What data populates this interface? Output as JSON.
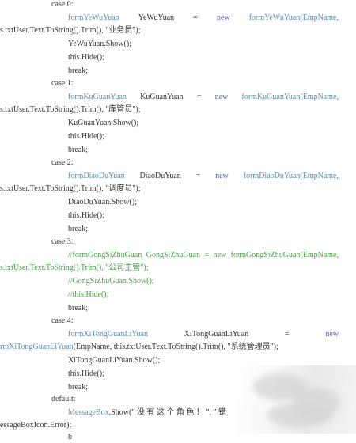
{
  "lines": [
    {
      "tokens": [
        {
          "text": "case 0:",
          "kind": "plain"
        }
      ]
    },
    {
      "tokens": [
        {
          "text": "formYeWuYuan",
          "kind": "type"
        },
        {
          "text": "YeWuYuan",
          "kind": "plain"
        },
        {
          "text": "=",
          "kind": "plain"
        },
        {
          "text": "new",
          "kind": "kw"
        },
        {
          "text": "formYeWuYuan(EmpName,",
          "kind": "type"
        }
      ]
    },
    {
      "tokens": [
        {
          "text": "s.txtUser.Text.ToString().Trim(), \"业务员\");",
          "kind": "plain"
        }
      ]
    },
    {
      "tokens": [
        {
          "text": "YeWuYuan.Show();",
          "kind": "plain"
        }
      ]
    },
    {
      "tokens": [
        {
          "text": "this.Hide();",
          "kind": "plain"
        }
      ]
    },
    {
      "tokens": [
        {
          "text": "break;",
          "kind": "plain"
        }
      ]
    },
    {
      "tokens": [
        {
          "text": "case 1:",
          "kind": "plain"
        }
      ]
    },
    {
      "tokens": [
        {
          "text": "formKuGuanYuan",
          "kind": "type"
        },
        {
          "text": "KuGuanYuan",
          "kind": "plain"
        },
        {
          "text": "=",
          "kind": "plain"
        },
        {
          "text": "new",
          "kind": "kw"
        },
        {
          "text": "formKuGuanYuan(EmpName,",
          "kind": "type"
        }
      ]
    },
    {
      "tokens": [
        {
          "text": "s.txtUser.Text.ToString().Trim(), \"库管员\");",
          "kind": "plain"
        }
      ]
    },
    {
      "tokens": [
        {
          "text": "KuGuanYuan.Show();",
          "kind": "plain"
        }
      ]
    },
    {
      "tokens": [
        {
          "text": "this.Hide();",
          "kind": "plain"
        }
      ]
    },
    {
      "tokens": [
        {
          "text": "break;",
          "kind": "plain"
        }
      ]
    },
    {
      "tokens": [
        {
          "text": "case 2:",
          "kind": "plain"
        }
      ]
    },
    {
      "tokens": [
        {
          "text": "formDiaoDuYuan",
          "kind": "type"
        },
        {
          "text": "DiaoDuYuan",
          "kind": "plain"
        },
        {
          "text": "=",
          "kind": "plain"
        },
        {
          "text": "new",
          "kind": "kw"
        },
        {
          "text": "formDiaoDuYuan(EmpName,",
          "kind": "type"
        }
      ]
    },
    {
      "tokens": [
        {
          "text": "s.txtUser.Text.ToString().Trim(), \"调度员\");",
          "kind": "plain"
        }
      ]
    },
    {
      "tokens": [
        {
          "text": "DiaoDuYuan.Show();",
          "kind": "plain"
        }
      ]
    },
    {
      "tokens": [
        {
          "text": "this.Hide();",
          "kind": "plain"
        }
      ]
    },
    {
      "tokens": [
        {
          "text": "break;",
          "kind": "plain"
        }
      ]
    },
    {
      "tokens": [
        {
          "text": "case 3:",
          "kind": "plain"
        }
      ]
    },
    {
      "tokens": [
        {
          "text": "//formGongSiZhuGuan",
          "kind": "comment"
        },
        {
          "text": "GongSiZhuGuan",
          "kind": "comment"
        },
        {
          "text": "=",
          "kind": "comment"
        },
        {
          "text": "new",
          "kind": "comment"
        },
        {
          "text": "formGongSiZhuGuan(EmpName,",
          "kind": "comment"
        }
      ]
    },
    {
      "tokens": [
        {
          "text": "s.txtUser.Text.ToString().Trim(), \"公司主管\");",
          "kind": "comment"
        }
      ]
    },
    {
      "tokens": [
        {
          "text": "//GongSiZhuGuan.Show();",
          "kind": "comment"
        }
      ]
    },
    {
      "tokens": [
        {
          "text": "//this.Hide();",
          "kind": "comment"
        }
      ]
    },
    {
      "tokens": [
        {
          "text": "break;",
          "kind": "plain"
        }
      ]
    },
    {
      "tokens": [
        {
          "text": "case 4:",
          "kind": "plain"
        }
      ]
    },
    {
      "tokens": [
        {
          "text": "formXiTongGuanLiYuan",
          "kind": "type"
        },
        {
          "text": "XiTongGuanLiYuan",
          "kind": "plain"
        },
        {
          "text": "=",
          "kind": "plain"
        },
        {
          "text": "new",
          "kind": "kw"
        }
      ]
    },
    {
      "tokens": [
        {
          "text": "rmXiTongGuanLiYuan",
          "kind": "type"
        },
        {
          "text": "(EmpName, this.txtUser.Text.ToString().Trim(), \"系统管理员\");",
          "kind": "plain"
        }
      ]
    },
    {
      "tokens": [
        {
          "text": "XiTongGuanLiYuan.Show();",
          "kind": "plain"
        }
      ]
    },
    {
      "tokens": [
        {
          "text": "this.Hide();",
          "kind": "plain"
        }
      ]
    },
    {
      "tokens": [
        {
          "text": "break;",
          "kind": "plain"
        }
      ]
    },
    {
      "tokens": [
        {
          "text": "default:",
          "kind": "plain"
        }
      ]
    },
    {
      "tokens": [
        {
          "text": "MessageBox",
          "kind": "type"
        },
        {
          "text": ".Show(\" 没 有 这 个 角 色 ！ \", \" 错",
          "kind": "plain"
        }
      ]
    },
    {
      "tokens": [
        {
          "text": "essageBoxIcon.Error);",
          "kind": "plain"
        }
      ]
    },
    {
      "tokens": [
        {
          "text": "b",
          "kind": "plain"
        }
      ]
    }
  ],
  "colors": {
    "type": "#5f8ba7",
    "keyword": "#5a64a8",
    "comment": "#4f9a4f",
    "text": "#262626"
  }
}
